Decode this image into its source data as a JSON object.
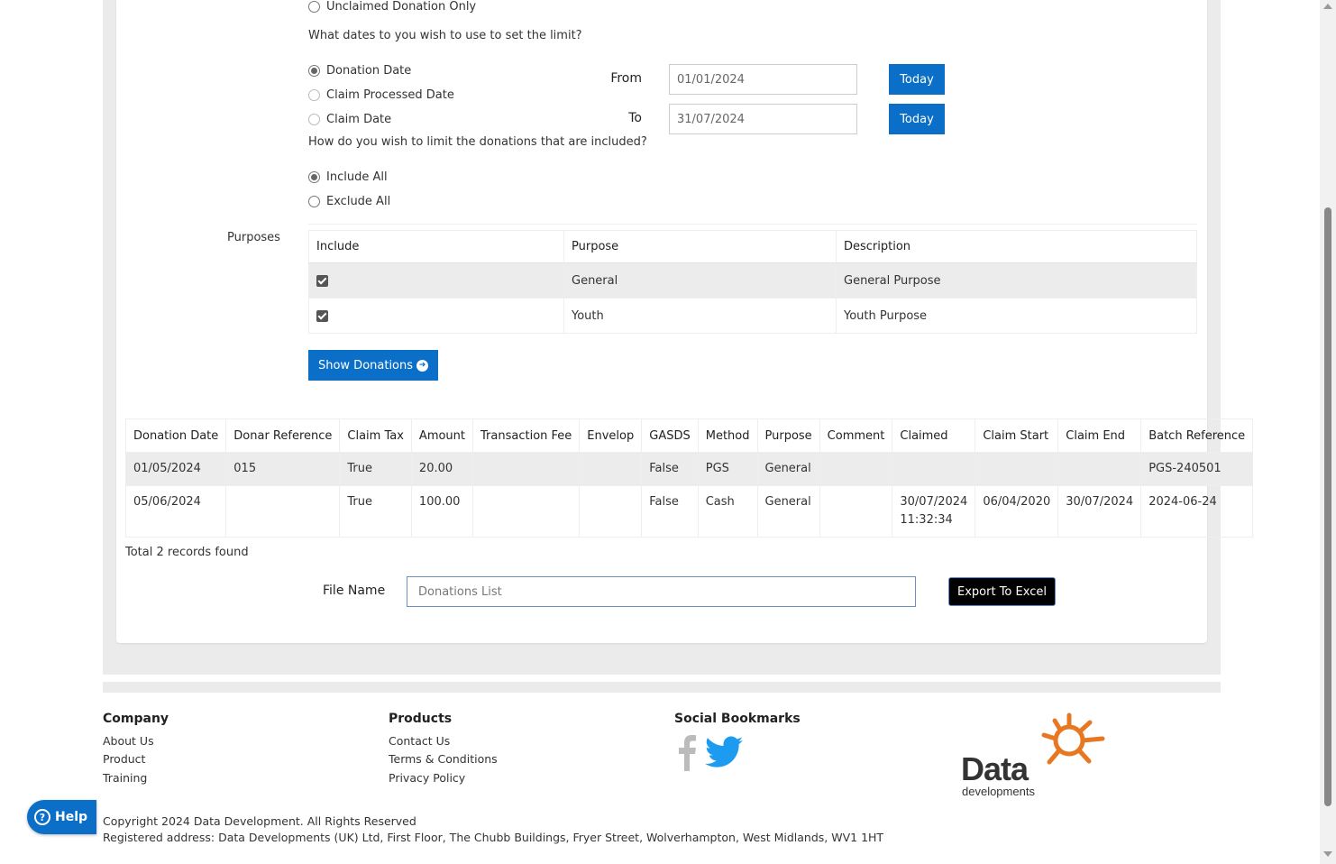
{
  "limit_options": {
    "unclaimed_only": "Unclaimed Donation Only",
    "dates_question": "What dates to you wish to use to set the limit?",
    "date_types": [
      "Donation Date",
      "Claim Processed Date",
      "Claim Date"
    ],
    "selected_date_type": "Donation Date",
    "from_label": "From",
    "to_label": "To",
    "from_value": "01/01/2024",
    "to_value": "31/07/2024",
    "today_label": "Today",
    "limit_question": "How do you wish to limit the donations that are included?",
    "include_options": [
      "Include All",
      "Exclude All"
    ],
    "selected_include": "Include All"
  },
  "purposes": {
    "label": "Purposes",
    "columns": [
      "Include",
      "Purpose",
      "Description"
    ],
    "rows": [
      {
        "include": true,
        "purpose": "General",
        "description": "General Purpose"
      },
      {
        "include": true,
        "purpose": "Youth",
        "description": "Youth Purpose"
      }
    ]
  },
  "show_donations_label": "Show Donations",
  "donations": {
    "columns": [
      "Donation Date",
      "Donar Reference",
      "Claim Tax",
      "Amount",
      "Transaction Fee",
      "Envelop",
      "GASDS",
      "Method",
      "Purpose",
      "Comment",
      "Claimed",
      "Claim Start",
      "Claim End",
      "Batch Reference"
    ],
    "rows": [
      [
        "01/05/2024",
        "015",
        "True",
        "20.00",
        "",
        "",
        "False",
        "PGS",
        "General",
        "",
        "",
        "",
        "",
        "PGS-240501"
      ],
      [
        "05/06/2024",
        "",
        "True",
        "100.00",
        "",
        "",
        "False",
        "Cash",
        "General",
        "",
        "30/07/2024 11:32:34",
        "06/04/2020",
        "30/07/2024",
        "2024-06-24"
      ]
    ],
    "total_text": "Total 2 records found"
  },
  "export": {
    "file_name_label": "File Name",
    "file_name_value": "Donations List",
    "export_label": "Export To Excel"
  },
  "footer": {
    "company_heading": "Company",
    "company_links": [
      "About Us",
      "Product",
      "Training"
    ],
    "products_heading": "Products",
    "products_links": [
      "Contact Us",
      "Terms & Conditions",
      "Privacy Policy"
    ],
    "social_heading": "Social Bookmarks",
    "social_icons": [
      "facebook-icon",
      "twitter-icon"
    ],
    "logo_text": "Data",
    "logo_subtext": "developments",
    "copyright": "Copyright 2024 Data Development. All Rights Reserved",
    "address": "Registered address: Data Developments (UK) Ltd, First Floor, The Chubb Buildings, Fryer Street, Wolverhampton, West Midlands, WV1 1HT"
  },
  "help_label": "Help",
  "colors": {
    "primary_blue": "#0b6fc8",
    "logo_orange": "#e87722",
    "logo_dark": "#333333"
  }
}
